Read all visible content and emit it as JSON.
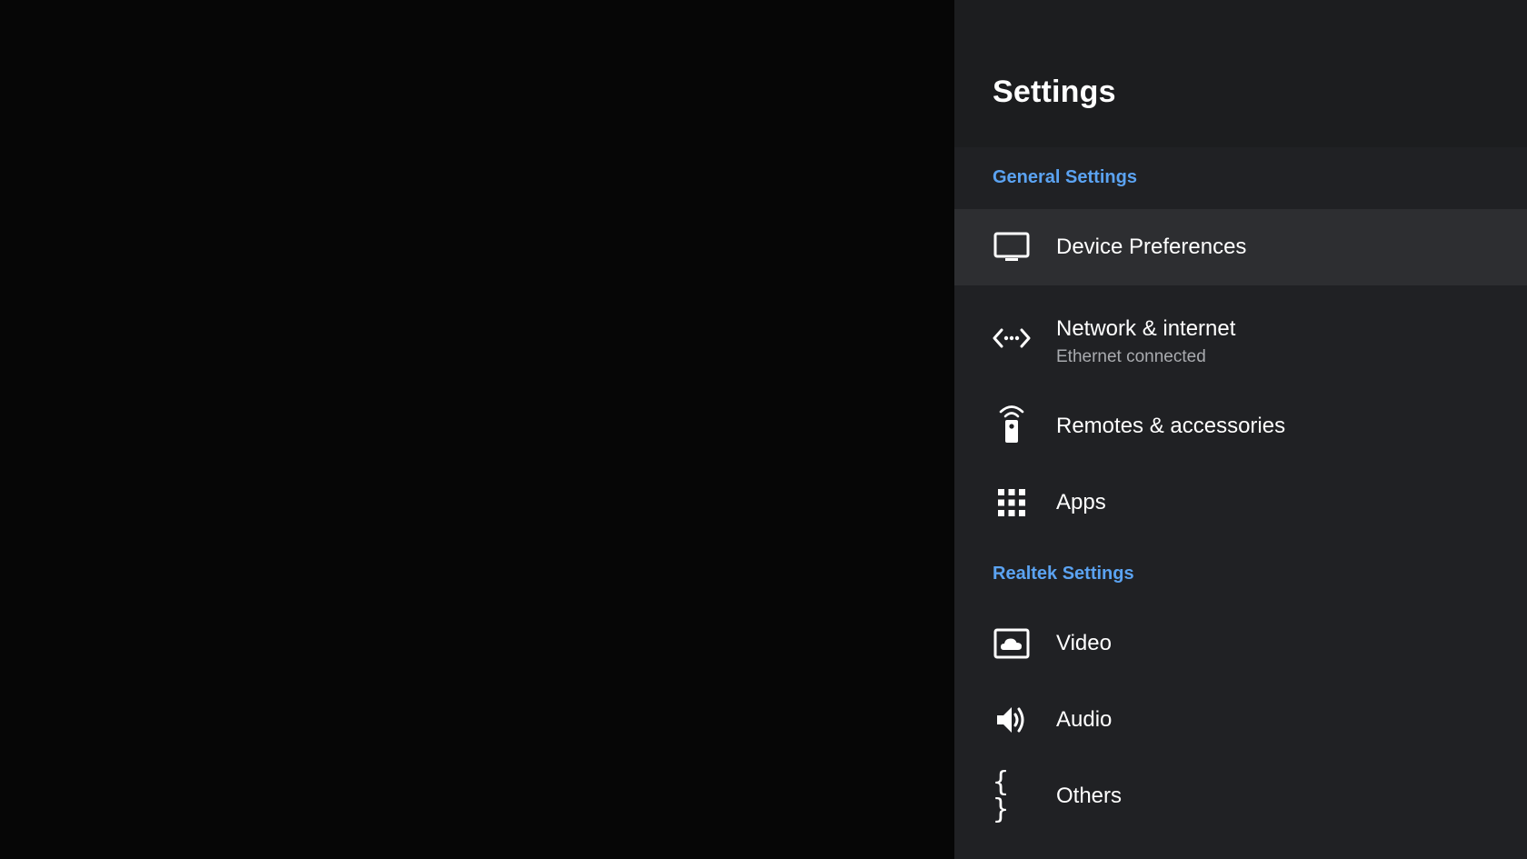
{
  "panel": {
    "title": "Settings",
    "sections": [
      {
        "heading": "General Settings",
        "items": [
          {
            "icon": "tv-icon",
            "label": "Device Preferences",
            "focused": true
          },
          {
            "icon": "network-icon",
            "label": "Network & internet",
            "sublabel": "Ethernet connected"
          },
          {
            "icon": "remote-icon",
            "label": "Remotes & accessories"
          },
          {
            "icon": "apps-grid-icon",
            "label": "Apps"
          }
        ]
      },
      {
        "heading": "Realtek Settings",
        "items": [
          {
            "icon": "video-icon",
            "label": "Video"
          },
          {
            "icon": "audio-icon",
            "label": "Audio"
          },
          {
            "icon": "braces-icon",
            "label": "Others",
            "icon_text": "{ }"
          }
        ]
      }
    ]
  },
  "colors": {
    "background": "#060606",
    "panel": "#202124",
    "panel_header": "#1c1d1f",
    "focused_item": "#2d2e31",
    "section_heading": "#5ba3f2",
    "primary_text": "#ffffff",
    "secondary_text": "#a9abaf"
  }
}
